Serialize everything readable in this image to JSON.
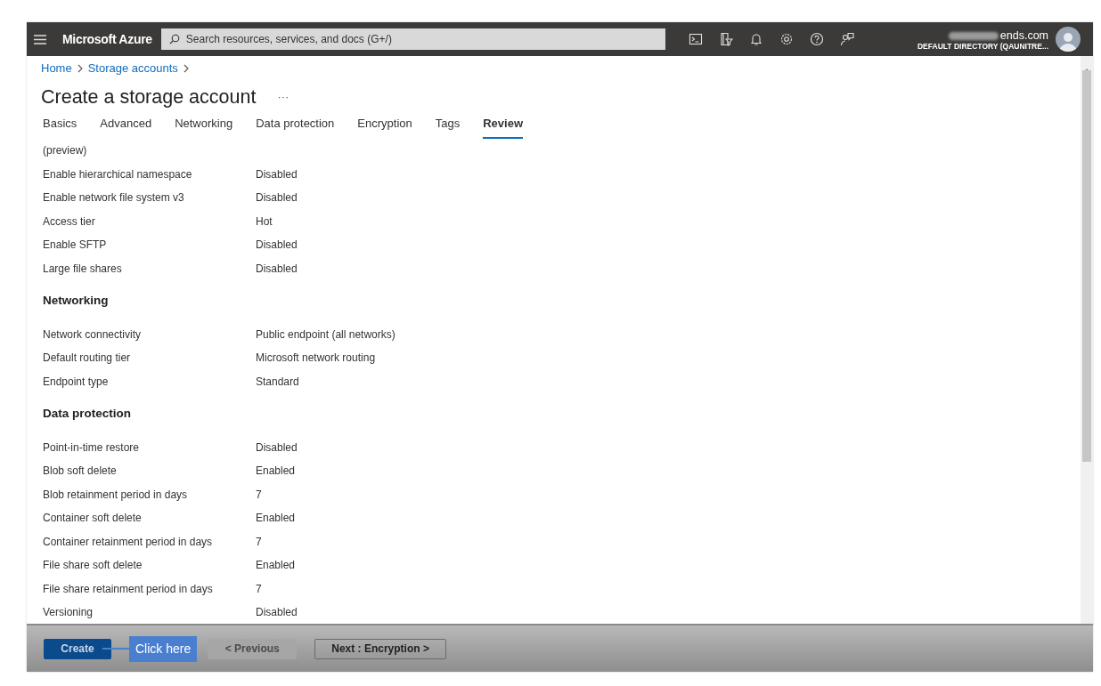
{
  "topbar": {
    "brand": "Microsoft Azure",
    "search": {
      "placeholder": "Search resources, services, and docs (G+/)"
    },
    "account": {
      "email": "ends.com",
      "directory": "DEFAULT DIRECTORY (QAUNITRE..."
    }
  },
  "breadcrumb": [
    "Home",
    "Storage accounts"
  ],
  "title": "Create a storage account",
  "more": "···",
  "tabs": [
    {
      "label": "Basics",
      "selected": false
    },
    {
      "label": "Advanced",
      "selected": false
    },
    {
      "label": "Networking",
      "selected": false
    },
    {
      "label": "Data protection",
      "selected": false
    },
    {
      "label": "Encryption",
      "selected": false
    },
    {
      "label": "Tags",
      "selected": false
    },
    {
      "label": "Review",
      "selected": true
    }
  ],
  "sections": [
    {
      "rows": [
        {
          "label": "(preview)"
        },
        {
          "label": "Enable hierarchical namespace",
          "value": "Disabled"
        },
        {
          "label": "Enable network file system v3",
          "value": "Disabled"
        },
        {
          "label": "Access tier",
          "value": "Hot"
        },
        {
          "label": "Enable SFTP",
          "value": "Disabled"
        },
        {
          "label": "Large file shares",
          "value": "Disabled"
        }
      ]
    },
    {
      "heading": "Networking",
      "rows": [
        {
          "label": "Network connectivity",
          "value": "Public endpoint (all networks)"
        },
        {
          "label": "Default routing tier",
          "value": "Microsoft network routing"
        },
        {
          "label": "Endpoint type",
          "value": "Standard"
        }
      ]
    },
    {
      "heading": "Data protection",
      "rows": [
        {
          "label": "Point-in-time restore",
          "value": "Disabled"
        },
        {
          "label": "Blob soft delete",
          "value": "Enabled"
        },
        {
          "label": "Blob retainment period in days",
          "value": "7"
        },
        {
          "label": "Container soft delete",
          "value": "Enabled"
        },
        {
          "label": "Container retainment period in days",
          "value": "7"
        },
        {
          "label": "File share soft delete",
          "value": "Enabled"
        },
        {
          "label": "File share retainment period in days",
          "value": "7"
        },
        {
          "label": "Versioning",
          "value": "Disabled"
        }
      ]
    }
  ],
  "footer": {
    "buttons": [
      {
        "label": "Create",
        "kind": "primary",
        "disabled": false
      },
      {
        "label": "< Previous",
        "kind": "secondary",
        "disabled": true
      },
      {
        "label": "Next : Encryption >",
        "kind": "secondary",
        "disabled": false
      }
    ],
    "callout": "Click here"
  }
}
